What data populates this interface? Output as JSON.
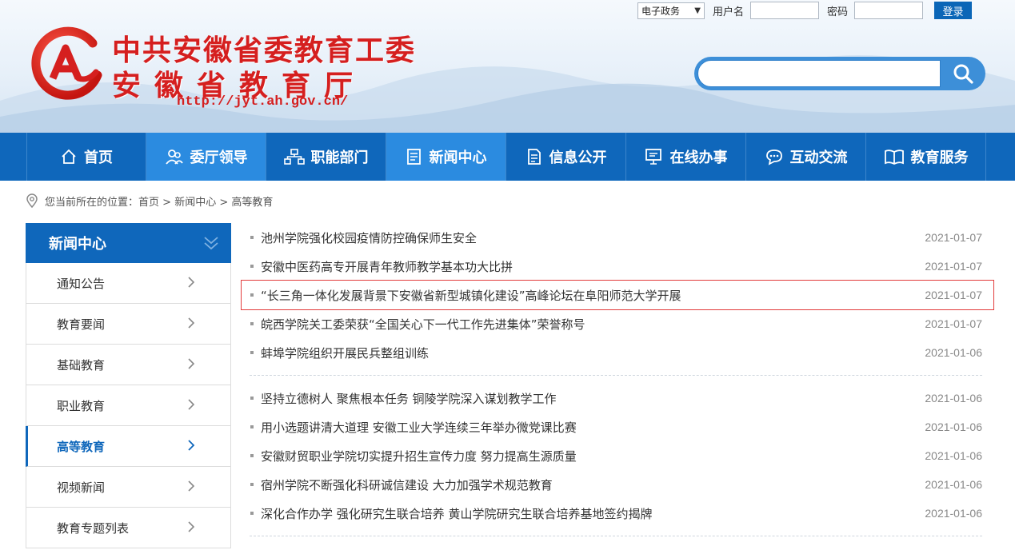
{
  "header": {
    "title_line1": "中共安徽省委教育工委",
    "title_line2": "安徽省教育厅",
    "url": "http://jyt.ah.gov.cn/",
    "system_select": "电子政务",
    "username_label": "用户名",
    "password_label": "密码",
    "login_label": "登录",
    "search_placeholder": ""
  },
  "nav": {
    "items": [
      {
        "label": "首页",
        "icon": "home-icon"
      },
      {
        "label": "委厅领导",
        "icon": "leaders-icon"
      },
      {
        "label": "职能部门",
        "icon": "org-chart-icon"
      },
      {
        "label": "新闻中心",
        "icon": "news-icon"
      },
      {
        "label": "信息公开",
        "icon": "document-icon"
      },
      {
        "label": "在线办事",
        "icon": "computer-icon"
      },
      {
        "label": "互动交流",
        "icon": "chat-icon"
      },
      {
        "label": "教育服务",
        "icon": "book-icon"
      }
    ]
  },
  "breadcrumb": {
    "prefix": "您当前所在的位置：",
    "path": [
      "首页",
      "新闻中心",
      "高等教育"
    ],
    "separator": ">"
  },
  "sidebar": {
    "title": "新闻中心",
    "items": [
      "通知公告",
      "教育要闻",
      "基础教育",
      "职业教育",
      "高等教育",
      "视频新闻",
      "教育专题列表"
    ],
    "active": "高等教育"
  },
  "news": {
    "group1": [
      {
        "title": "池州学院强化校园疫情防控确保师生安全",
        "date": "2021-01-07"
      },
      {
        "title": "安徽中医药高专开展青年教师教学基本功大比拼",
        "date": "2021-01-07"
      },
      {
        "title": "“长三角一体化发展背景下安徽省新型城镇化建设”高峰论坛在阜阳师范大学开展",
        "date": "2021-01-07"
      },
      {
        "title": "皖西学院关工委荣获“全国关心下一代工作先进集体”荣誉称号",
        "date": "2021-01-07"
      },
      {
        "title": "蚌埠学院组织开展民兵整组训练",
        "date": "2021-01-06"
      }
    ],
    "group2": [
      {
        "title": "坚持立德树人 聚焦根本任务 铜陵学院深入谋划教学工作",
        "date": "2021-01-06"
      },
      {
        "title": "用小选题讲清大道理 安徽工业大学连续三年举办微党课比赛",
        "date": "2021-01-06"
      },
      {
        "title": "安徽财贸职业学院切实提升招生宣传力度 努力提高生源质量",
        "date": "2021-01-06"
      },
      {
        "title": "宿州学院不断强化科研诚信建设 大力加强学术规范教育",
        "date": "2021-01-06"
      },
      {
        "title": "深化合作办学 强化研究生联合培养 黄山学院研究生联合培养基地签约揭牌",
        "date": "2021-01-06"
      }
    ],
    "highlighted_index": 2
  },
  "colors": {
    "brand_blue": "#0f67bb",
    "active_blue": "#2b8be0",
    "title_red": "#d51f1f",
    "highlight_border": "#e23b3b"
  }
}
